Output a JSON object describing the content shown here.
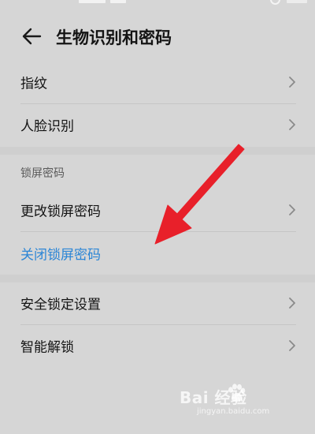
{
  "page": {
    "title": "生物识别和密码"
  },
  "icons": {
    "back": "arrow-left-icon",
    "chevron": "chevron-right-icon"
  },
  "biometrics": {
    "items": [
      {
        "label": "指纹"
      },
      {
        "label": "人脸识别"
      }
    ]
  },
  "lock_screen": {
    "header": "锁屏密码",
    "items": [
      {
        "label": "更改锁屏密码"
      },
      {
        "label": "关闭锁屏密码"
      }
    ]
  },
  "security": {
    "items": [
      {
        "label": "安全锁定设置"
      },
      {
        "label": "智能解锁"
      }
    ]
  },
  "watermark": {
    "brand": "Bai 经验",
    "url": "jingyan.baidu.com"
  },
  "colors": {
    "background": "#d6d6d6",
    "accent_link": "#2c86d6",
    "annotation_arrow": "#e8202a"
  }
}
